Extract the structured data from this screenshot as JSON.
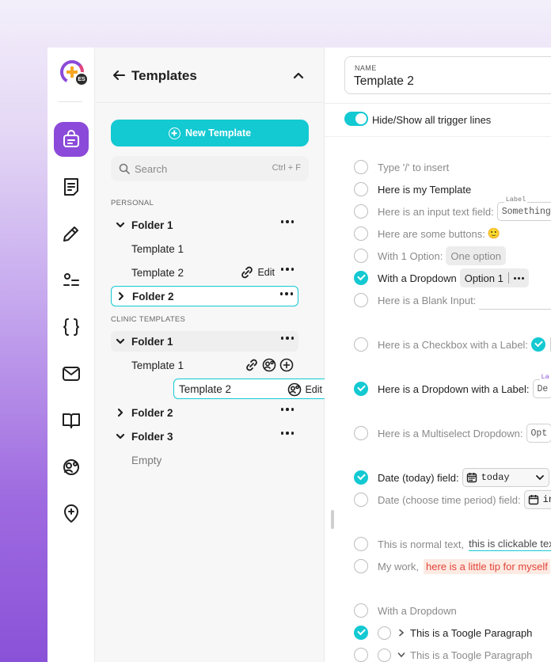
{
  "colors": {
    "accent": "#13c9d2",
    "purple": "#8b4ad9"
  },
  "rail": {
    "avatar_initials": "ES",
    "items": [
      {
        "icon": "template-bag-icon",
        "active": true
      },
      {
        "icon": "document-icon"
      },
      {
        "icon": "pencil-icon"
      },
      {
        "icon": "list-icon"
      },
      {
        "icon": "braces-icon"
      },
      {
        "icon": "mail-icon"
      },
      {
        "icon": "book-icon"
      },
      {
        "icon": "user-settings-icon"
      },
      {
        "icon": "add-location-icon"
      }
    ]
  },
  "panel": {
    "title": "Templates",
    "new_button": "New Template",
    "search": {
      "placeholder": "Search",
      "shortcut": "Ctrl + F"
    },
    "personal_label": "PERSONAL",
    "clinic_label": "CLINIC TEMPLATES",
    "personal": {
      "folder1": "Folder 1",
      "template1": "Template 1",
      "template2": "Template 2",
      "edit": "Edit",
      "folder2": "Folder 2"
    },
    "clinic": {
      "folder1": "Folder 1",
      "template1": "Template 1",
      "template2": "Template 2",
      "edit": "Edit",
      "folder2": "Folder 2",
      "folder3": "Folder 3",
      "empty": "Empty"
    }
  },
  "editor": {
    "name_label": "NAME",
    "name_value": "Template 2",
    "toggle_label": "Hide/Show all trigger lines",
    "toggle_on": true,
    "lines": {
      "l1": "Type '/' to insert",
      "l2": "Here is my Template",
      "l3": "Here is an input text field:",
      "l3_field_label": "Label",
      "l3_field_value": "Something",
      "l4": "Here are some buttons:",
      "l4_emoji": "🙂",
      "l5": "With 1 Option:",
      "l5_option": "One option",
      "l6": "With a Dropdown",
      "l6_option": "Option 1",
      "l7": "Here is a Blank Input:",
      "l8": "Here is a Checkbox with a Label:",
      "l9": "Here is a Dropdown with a Label:",
      "l9_field_label": "La",
      "l9_field_value": "De",
      "l10": "Here is a Multiselect Dropdown:",
      "l10_value": "Opt",
      "l11": "Date (today) field:",
      "l11_value": "today",
      "l12": "Date (choose time period) field:",
      "l12_value": "in",
      "l13": "This is normal text,",
      "l13_link": "this is clickable text",
      "l14": "My work,",
      "l14_tip": "here is a little tip for myself",
      "l15": "With a Dropdown",
      "l16": "This is a Toogle Paragraph",
      "l17": "This is a Toogle Paragraph"
    }
  }
}
